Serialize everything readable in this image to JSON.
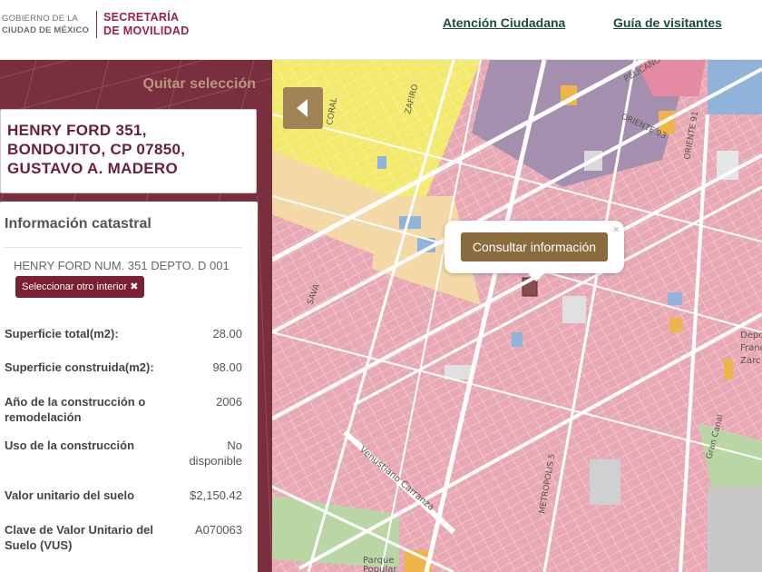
{
  "header": {
    "logo_line1": "GOBIERNO DE LA",
    "logo_line2": "CIUDAD DE MÉXICO",
    "agency_line1": "SECRETARÍA",
    "agency_line2": "DE MOVILIDAD",
    "nav": [
      {
        "label": "Atención Ciudadana"
      },
      {
        "label": "Guía de visitantes"
      }
    ]
  },
  "sidebar": {
    "clear_selection": "Quitar selección",
    "address": "HENRY FORD 351,\nBONDOJITO, CP 07850,\nGUSTAVO A. MADERO",
    "panel_title": "Información catastral",
    "interior_text": "HENRY FORD NUM. 351 DEPTO. D 001",
    "interior_button": "Seleccionar otro interior ✖",
    "fields": [
      {
        "label": "Superficie total(m2):",
        "value": "28.00"
      },
      {
        "label": "Superficie construida(m2):",
        "value": "98.00"
      },
      {
        "label": "Año de la construcción o remodelación",
        "value": "2006"
      },
      {
        "label": "Uso de la construcción",
        "value": "No disponible"
      },
      {
        "label": "Valor unitario del suelo",
        "value": "$2,150.42"
      },
      {
        "label": "Clave de Valor Unitario del Suelo (VUS)",
        "value": "A070063"
      }
    ]
  },
  "map": {
    "popup_button": "Consultar información",
    "popup_close": "×",
    "street_labels": [
      "CORAL",
      "ZAFIRO",
      "PELICANO",
      "ORIENTE 93",
      "ORIENTE 91",
      "SAVA",
      "Venustiano Carranza",
      "METROPOLIS 5",
      "Gran Canal",
      "Depor",
      "Franc",
      "Zarc",
      "Parque",
      "Popular"
    ],
    "colors": {
      "residential": "#e8a9b4",
      "commercial": "#f3e96b",
      "mixed": "#f4d9a7",
      "services": "#a48fae",
      "public": "#8fb3d9",
      "green": "#b9d6a4",
      "selected": "#8a4b4e",
      "roads": "#ffffff"
    }
  },
  "icons": {
    "collapse": "chevron-left-icon",
    "close": "close-icon"
  }
}
